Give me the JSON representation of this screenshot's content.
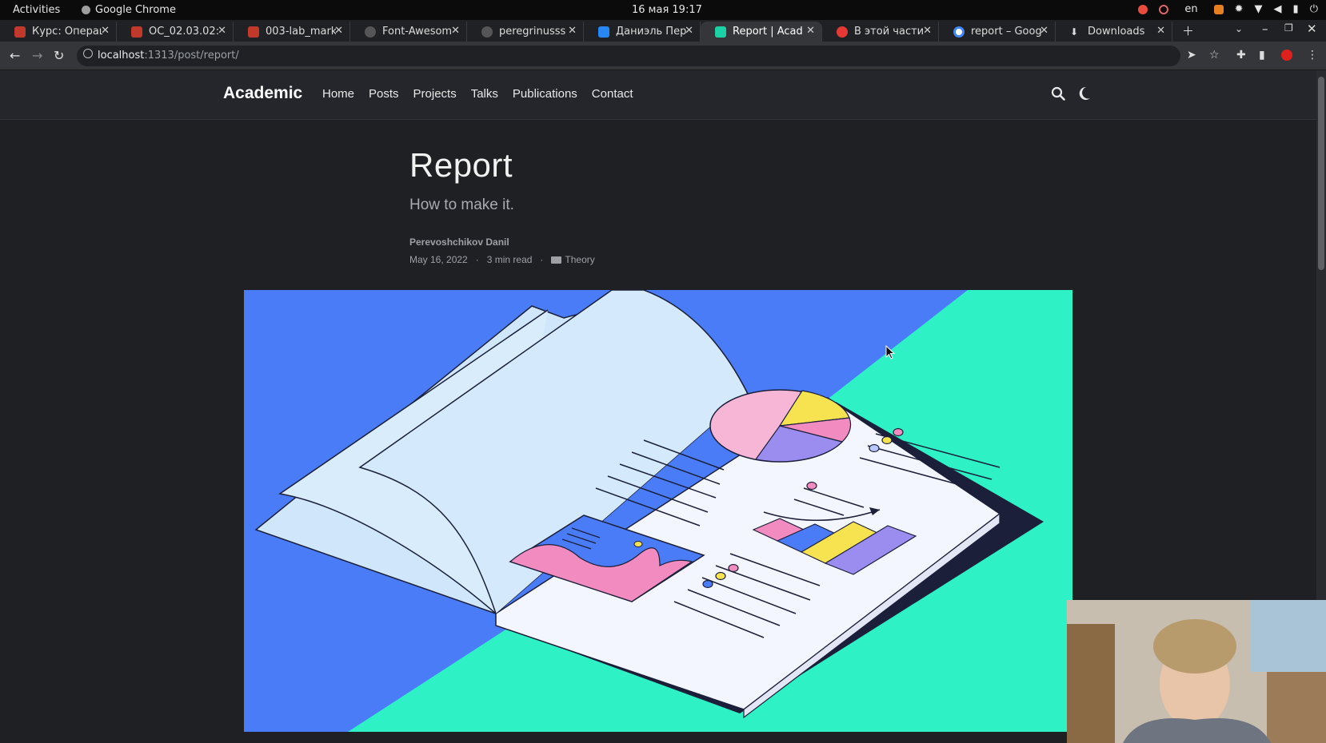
{
  "system": {
    "activities": "Activities",
    "app_name": "Google Chrome",
    "clock": "16 мая  19:17",
    "lang": "en"
  },
  "tabs": [
    {
      "title": "Курс: Операци",
      "color": "#c0392b"
    },
    {
      "title": "ОС_02.03.02: Э",
      "color": "#c0392b"
    },
    {
      "title": "003-lab_markd",
      "color": "#c0392b"
    },
    {
      "title": "Font-Awesome",
      "color": "#555555"
    },
    {
      "title": "peregrinusss (",
      "color": "#555555"
    },
    {
      "title": "Даниэль Пере",
      "color": "#2787f5"
    },
    {
      "title": "Report | Acade",
      "color": "#1bd1a5"
    },
    {
      "title": "В этой части р",
      "color": "#e53935"
    },
    {
      "title": "report – Google",
      "color": "#4285f4"
    },
    {
      "title": "Downloads",
      "color": "#dddddd"
    }
  ],
  "address": {
    "host": "localhost",
    "path": ":1313/post/report/"
  },
  "site": {
    "brand": "Academic",
    "menu": [
      "Home",
      "Posts",
      "Projects",
      "Talks",
      "Publications",
      "Contact"
    ]
  },
  "post": {
    "title": "Report",
    "subtitle": "How to make it.",
    "author": "Perevoshchikov Danil",
    "date": "May 16, 2022",
    "reading_time": "3 min read",
    "category": "Theory"
  },
  "colors": {
    "accent_blue": "#4a7cf7",
    "accent_green": "#2ef2c6",
    "page_bg": "#1f2024"
  }
}
